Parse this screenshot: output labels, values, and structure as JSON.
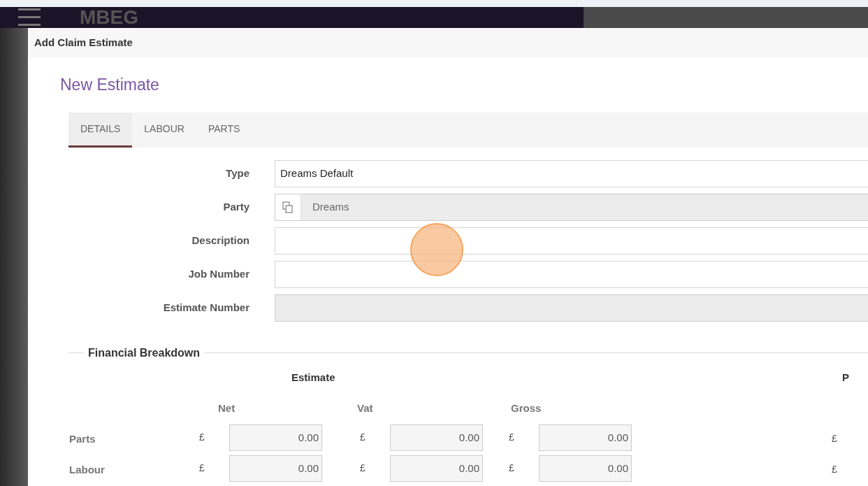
{
  "app_header": {
    "logo": "MBEG"
  },
  "dialog": {
    "title": "Add Claim Estimate",
    "heading": "New Estimate",
    "tabs": [
      {
        "label": "DETAILS",
        "selected": true
      },
      {
        "label": "LABOUR",
        "selected": false
      },
      {
        "label": "PARTS",
        "selected": false
      }
    ],
    "fields": [
      {
        "label": "Type",
        "value": "Dreams Default",
        "disabled": false,
        "kind": "text"
      },
      {
        "label": "Party",
        "value": "Dreams",
        "disabled": true,
        "kind": "lookup"
      },
      {
        "label": "Description",
        "disabled": false,
        "kind": "text"
      },
      {
        "label": "Job Number",
        "disabled": false,
        "kind": "text"
      },
      {
        "label": "Estimate Number",
        "disabled": true,
        "kind": "text"
      }
    ],
    "financial_breakdown": {
      "title": "Financial Breakdown",
      "group": "Estimate",
      "column_group_2": "P",
      "columns": [
        "Net",
        "Vat",
        "Gross"
      ],
      "rows": [
        {
          "label": "Parts",
          "currency": "£",
          "values": [
            "0.00",
            "0.00",
            "0.00"
          ],
          "column_4_currency": "£"
        },
        {
          "label": "Labour",
          "currency": "£",
          "values": [
            "0.00",
            "0.00",
            "0.00"
          ],
          "column_4_currency": "£"
        }
      ]
    }
  }
}
